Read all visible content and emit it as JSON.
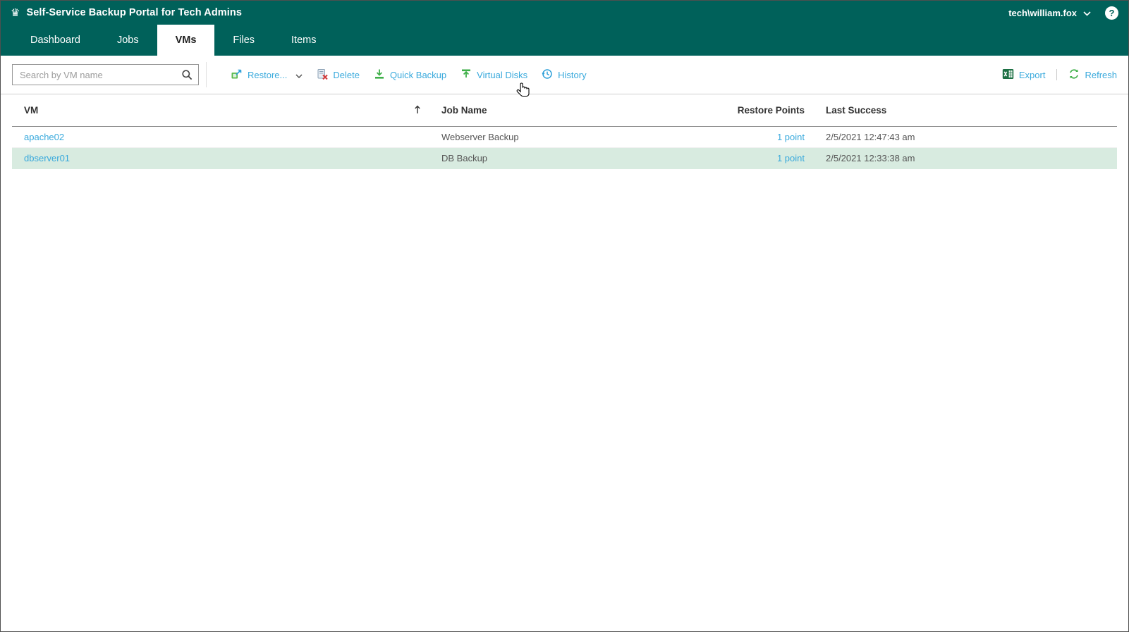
{
  "header": {
    "title": "Self-Service Backup Portal for Tech Admins",
    "user": "tech\\william.fox"
  },
  "icons": {
    "logo_glyph": "♛",
    "help_glyph": "?"
  },
  "nav": {
    "tabs": [
      {
        "label": "Dashboard",
        "active": false
      },
      {
        "label": "Jobs",
        "active": false
      },
      {
        "label": "VMs",
        "active": true
      },
      {
        "label": "Files",
        "active": false
      },
      {
        "label": "Items",
        "active": false
      }
    ]
  },
  "toolbar": {
    "search_placeholder": "Search by VM name",
    "restore": "Restore...",
    "delete": "Delete",
    "quick_backup": "Quick Backup",
    "virtual_disks": "Virtual Disks",
    "history": "History",
    "export": "Export",
    "refresh": "Refresh"
  },
  "table": {
    "columns": {
      "vm": "VM",
      "job": "Job Name",
      "points": "Restore Points",
      "last": "Last Success"
    },
    "sort": {
      "column": "VM",
      "direction": "ascending"
    },
    "rows": [
      {
        "vm": "apache02",
        "job": "Webserver Backup",
        "points": "1 point",
        "last": "2/5/2021 12:47:43 am",
        "selected": false
      },
      {
        "vm": "dbserver01",
        "job": "DB Backup",
        "points": "1 point",
        "last": "2/5/2021 12:33:38 am",
        "selected": true
      }
    ]
  },
  "colors": {
    "header_bg": "#00615a",
    "link": "#38a9dc",
    "selected_row": "#d8ebe0",
    "accent_green": "#3faf49"
  }
}
